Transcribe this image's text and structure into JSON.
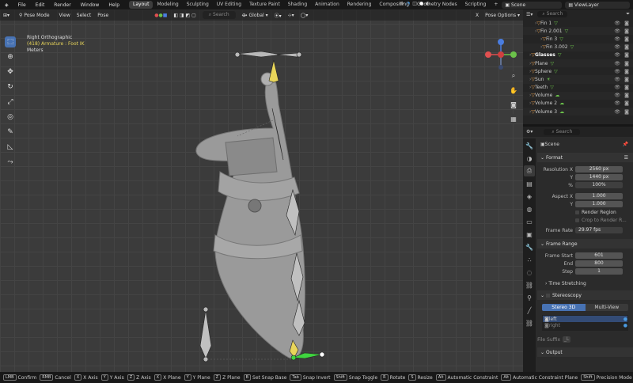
{
  "menu": [
    "File",
    "Edit",
    "Render",
    "Window",
    "Help"
  ],
  "workspaces": [
    "Layout",
    "Modeling",
    "Sculpting",
    "UV Editing",
    "Texture Paint",
    "Shading",
    "Animation",
    "Rendering",
    "Compositing",
    "Geometry Nodes",
    "Scripting"
  ],
  "active_workspace": "Layout",
  "add_workspace": "+",
  "scene": "Scene",
  "view_layer": "ViewLayer",
  "viewport": {
    "mode": "Pose Mode",
    "menus": [
      "View",
      "Select",
      "Pose"
    ],
    "transform": "Global",
    "search_placeholder": "Search",
    "x_close": "X",
    "pose_options": "Pose Options",
    "overlay_title": "Right Orthographic",
    "overlay_sub": "(418) Armature : Foot IK",
    "overlay_units": "Meters",
    "axis_x": "X",
    "axis_y": "Y",
    "axis_z": "Z"
  },
  "outliner": {
    "search_placeholder": "Search",
    "rows": [
      {
        "name": "Fin 1",
        "indent": 1,
        "icon": "triangle-icon"
      },
      {
        "name": "Fin 2.001",
        "indent": 1,
        "icon": "triangle-icon"
      },
      {
        "name": "Fin 3",
        "indent": 2,
        "icon": "triangle-icon"
      },
      {
        "name": "Fin 3.002",
        "indent": 2,
        "icon": "triangle-icon"
      },
      {
        "name": "Glasses",
        "indent": 0,
        "icon": "triangle-icon",
        "hl": true
      },
      {
        "name": "Plane",
        "indent": 0,
        "icon": "triangle-icon"
      },
      {
        "name": "Sphere",
        "indent": 0,
        "icon": "triangle-icon"
      },
      {
        "name": "Sun",
        "indent": 0,
        "icon": "sun-icon"
      },
      {
        "name": "Teeth",
        "indent": 0,
        "icon": "triangle-icon"
      },
      {
        "name": "Volume",
        "indent": 0,
        "icon": "cloud-icon"
      },
      {
        "name": "Volume 2",
        "indent": 0,
        "icon": "cloud-icon"
      },
      {
        "name": "Volume 3",
        "indent": 0,
        "icon": "cloud-icon"
      }
    ]
  },
  "properties": {
    "search_placeholder": "Search",
    "context": "Scene",
    "format": {
      "title": "Format",
      "rows": [
        {
          "label": "Resolution X",
          "value": "2560 px"
        },
        {
          "label": "Y",
          "value": "1440 px"
        },
        {
          "label": "%",
          "value": "100%"
        },
        {
          "label": "Aspect X",
          "value": "1.000"
        },
        {
          "label": "Y",
          "value": "1.000"
        }
      ],
      "render_region": "Render Region",
      "crop": "Crop to Render R...",
      "frame_rate_label": "Frame Rate",
      "frame_rate": "29.97 fps"
    },
    "frame_range": {
      "title": "Frame Range",
      "rows": [
        {
          "label": "Frame Start",
          "value": "601"
        },
        {
          "label": "End",
          "value": "800"
        },
        {
          "label": "Step",
          "value": "1"
        }
      ]
    },
    "time_stretching": "Time Stretching",
    "stereoscopy": {
      "title": "Stereoscopy",
      "tab_a": "Stereo 3D",
      "tab_b": "Multi-View",
      "left": "left",
      "right": "right",
      "file_suffix": "File Suffix",
      "suffix_value": "_L"
    },
    "output_title": "Output"
  },
  "status": [
    {
      "key": "LMB",
      "label": "Confirm"
    },
    {
      "key": "RMB",
      "label": "Cancel"
    },
    {
      "key": "X",
      "label": "X Axis"
    },
    {
      "key": "Y",
      "label": "Y Axis"
    },
    {
      "key": "Z",
      "label": "Z Axis"
    },
    {
      "key": "X",
      "label": "X Plane"
    },
    {
      "key": "Y",
      "label": "Y Plane"
    },
    {
      "key": "Z",
      "label": "Z Plane"
    },
    {
      "key": "B",
      "label": "Set Snap Base"
    },
    {
      "key": "Tab",
      "label": "Snap Invert"
    },
    {
      "key": "Shift",
      "label": "Snap Toggle"
    },
    {
      "key": "R",
      "label": "Rotate"
    },
    {
      "key": "S",
      "label": "Resize"
    },
    {
      "key": "Alt",
      "label": "Automatic Constraint"
    },
    {
      "key": "Alt",
      "label": "Automatic Constraint Plane"
    },
    {
      "key": "Shift",
      "label": "Precision Mode"
    }
  ],
  "colors": {
    "accent": "#4772b3",
    "bone_select": "#e8d55a",
    "bone_active": "#3fd43f"
  }
}
